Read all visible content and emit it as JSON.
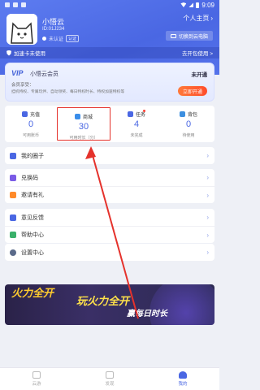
{
  "status_bar": {
    "time": "9:09"
  },
  "profile": {
    "nickname": "小悟云",
    "uid": "ID:01J234",
    "verify_text": "未认证",
    "verify_tag": "认证",
    "homepage_label": "个人主页",
    "switch_label": "切换到云电脑"
  },
  "accel_bar": {
    "left": "加速卡未使用",
    "right": "去开包使用 >"
  },
  "vip": {
    "logo": "VIP",
    "name": "小悟云会员",
    "state": "未开通",
    "benefit_title": "会员享受：",
    "benefits": "挂机特权、专属玩伴、自动领奖、每日特权时长、特权加速特权等",
    "open_button": "立即开通"
  },
  "stats": [
    {
      "label": "充值",
      "value": "0",
      "sub": "可用账币",
      "color": "#4a67e3"
    },
    {
      "label": "商城",
      "value": "30",
      "sub": "可用时长（分）",
      "color": "#3a8dea"
    },
    {
      "label": "任务",
      "value": "4",
      "sub": "未完成",
      "color": "#4a67e3"
    },
    {
      "label": "背包",
      "value": "0",
      "sub": "待使用",
      "color": "#3c8fe0"
    }
  ],
  "menu1": [
    {
      "label": "我的圈子",
      "color": "#4a67e3"
    }
  ],
  "menu2": [
    {
      "label": "兑换码",
      "color": "#7a5be6"
    },
    {
      "label": "邀请有礼",
      "color": "#ff8a2a"
    }
  ],
  "menu3": [
    {
      "label": "意见反馈",
      "color": "#4a67e3"
    },
    {
      "label": "帮助中心",
      "color": "#3ab06a"
    }
  ],
  "menu4": [
    {
      "label": "设置中心",
      "color": "#5a6a8a"
    }
  ],
  "banner": {
    "left_title": "火力全开",
    "title": "玩火力全开",
    "subtitle": "赢每日时长"
  },
  "tabbar": [
    {
      "label": "云游"
    },
    {
      "label": "发现"
    },
    {
      "label": "我的"
    }
  ]
}
